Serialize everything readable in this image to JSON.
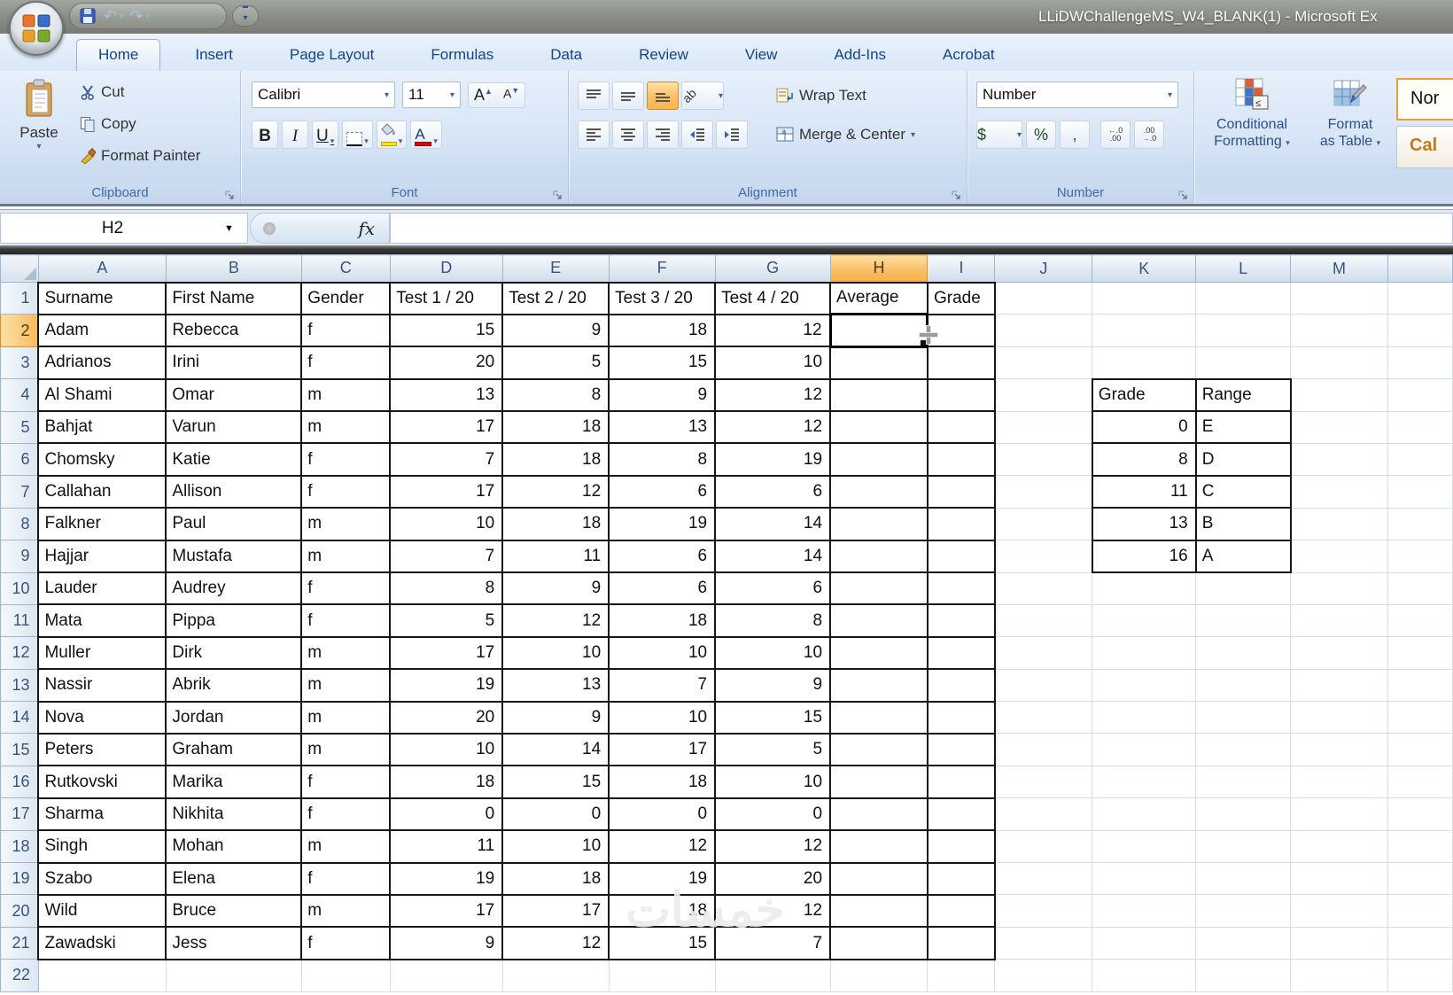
{
  "window": {
    "title": "LLiDWChallengeMS_W4_BLANK(1) - Microsoft Ex"
  },
  "tabs": [
    {
      "label": "Home",
      "active": true
    },
    {
      "label": "Insert",
      "active": false
    },
    {
      "label": "Page Layout",
      "active": false
    },
    {
      "label": "Formulas",
      "active": false
    },
    {
      "label": "Data",
      "active": false
    },
    {
      "label": "Review",
      "active": false
    },
    {
      "label": "View",
      "active": false
    },
    {
      "label": "Add-Ins",
      "active": false
    },
    {
      "label": "Acrobat",
      "active": false
    }
  ],
  "ribbon": {
    "clipboard": {
      "label": "Clipboard",
      "paste": "Paste",
      "cut": "Cut",
      "copy": "Copy",
      "format_painter": "Format Painter"
    },
    "font": {
      "label": "Font",
      "font_name": "Calibri",
      "font_size": "11",
      "bold": "B",
      "italic": "I",
      "underline": "U"
    },
    "alignment": {
      "label": "Alignment",
      "wrap_text": "Wrap Text",
      "merge_center": "Merge & Center",
      "orientation": "ab"
    },
    "number": {
      "label": "Number",
      "format": "Number",
      "currency": "$",
      "percent": "%",
      "comma": ",",
      "inc_decimal": ".00",
      "dec_decimal": ".00"
    },
    "styles": {
      "conditional_line1": "Conditional",
      "conditional_line2": "Formatting",
      "format_table_line1": "Format",
      "format_table_line2": "as Table",
      "style_normal": "Nor",
      "style_calculation": "Cal"
    }
  },
  "formula_bar": {
    "name_box": "H2",
    "fx": "fx",
    "formula": ""
  },
  "sheet": {
    "selected_cell": "H2",
    "selected_col": "H",
    "selected_row": 2,
    "row_count": 22,
    "col_letters": [
      "A",
      "B",
      "C",
      "D",
      "E",
      "F",
      "G",
      "H",
      "I",
      "J",
      "K",
      "L",
      "M"
    ],
    "header_row": [
      "Surname",
      "First Name",
      "Gender",
      "Test 1 / 20",
      "Test 2 / 20",
      "Test 3 / 20",
      "Test 4 / 20",
      "Average",
      "Grade"
    ],
    "rows": [
      [
        "Adam",
        "Rebecca",
        "f",
        "15",
        "9",
        "18",
        "12"
      ],
      [
        "Adrianos",
        "Irini",
        "f",
        "20",
        "5",
        "15",
        "10"
      ],
      [
        "Al Shami",
        "Omar",
        "m",
        "13",
        "8",
        "9",
        "12"
      ],
      [
        "Bahjat",
        "Varun",
        "m",
        "17",
        "18",
        "13",
        "12"
      ],
      [
        "Chomsky",
        "Katie",
        "f",
        "7",
        "18",
        "8",
        "19"
      ],
      [
        "Callahan",
        "Allison",
        "f",
        "17",
        "12",
        "6",
        "6"
      ],
      [
        "Falkner",
        "Paul",
        "m",
        "10",
        "18",
        "19",
        "14"
      ],
      [
        "Hajjar",
        "Mustafa",
        "m",
        "7",
        "11",
        "6",
        "14"
      ],
      [
        "Lauder",
        "Audrey",
        "f",
        "8",
        "9",
        "6",
        "6"
      ],
      [
        "Mata",
        "Pippa",
        "f",
        "5",
        "12",
        "18",
        "8"
      ],
      [
        "Muller",
        "Dirk",
        "m",
        "17",
        "10",
        "10",
        "10"
      ],
      [
        "Nassir",
        "Abrik",
        "m",
        "19",
        "13",
        "7",
        "9"
      ],
      [
        "Nova",
        "Jordan",
        "m",
        "20",
        "9",
        "10",
        "15"
      ],
      [
        "Peters",
        "Graham",
        "m",
        "10",
        "14",
        "17",
        "5"
      ],
      [
        "Rutkovski",
        "Marika",
        "f",
        "18",
        "15",
        "18",
        "10"
      ],
      [
        "Sharma",
        "Nikhita",
        "f",
        "0",
        "0",
        "0",
        "0"
      ],
      [
        "Singh",
        "Mohan",
        "m",
        "11",
        "10",
        "12",
        "12"
      ],
      [
        "Szabo",
        "Elena",
        "f",
        "19",
        "18",
        "19",
        "20"
      ],
      [
        "Wild",
        "Bruce",
        "m",
        "17",
        "17",
        "18",
        "12"
      ],
      [
        "Zawadski",
        "Jess",
        "f",
        "9",
        "12",
        "15",
        "7"
      ]
    ],
    "lookup_table": {
      "headers": [
        "Grade",
        "Range"
      ],
      "rows": [
        [
          "0",
          "E"
        ],
        [
          "8",
          "D"
        ],
        [
          "11",
          "C"
        ],
        [
          "13",
          "B"
        ],
        [
          "16",
          "A"
        ]
      ]
    },
    "watermark": "خمسات"
  }
}
